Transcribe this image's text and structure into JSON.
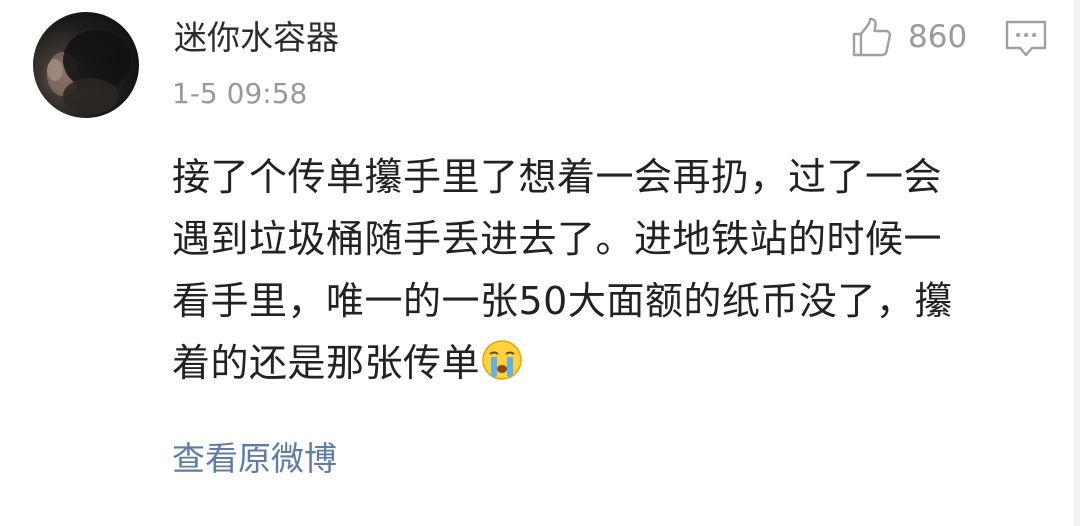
{
  "comment": {
    "username": "迷你水容器",
    "timestamp": "1-5 09:58",
    "like_count": "860",
    "content_lines": [
      "接了个传单攥手里了想着一会再扔，过了一会",
      "遇到垃圾桶随手丢进去了。进地铁站的时候一",
      "看手里，唯一的一张50大面额的纸币没了，攥",
      "着的还是那张传单"
    ],
    "emoji_name": "crying-face-icon",
    "view_original_label": "查看原微博"
  },
  "icons": {
    "like": "thumbs-up-icon",
    "comment": "comment-bubble-icon"
  },
  "colors": {
    "username": "#2c2c2c",
    "timestamp": "#999999",
    "content": "#222222",
    "link": "#5f7ba8",
    "icon_gray": "#9a9a9a"
  }
}
